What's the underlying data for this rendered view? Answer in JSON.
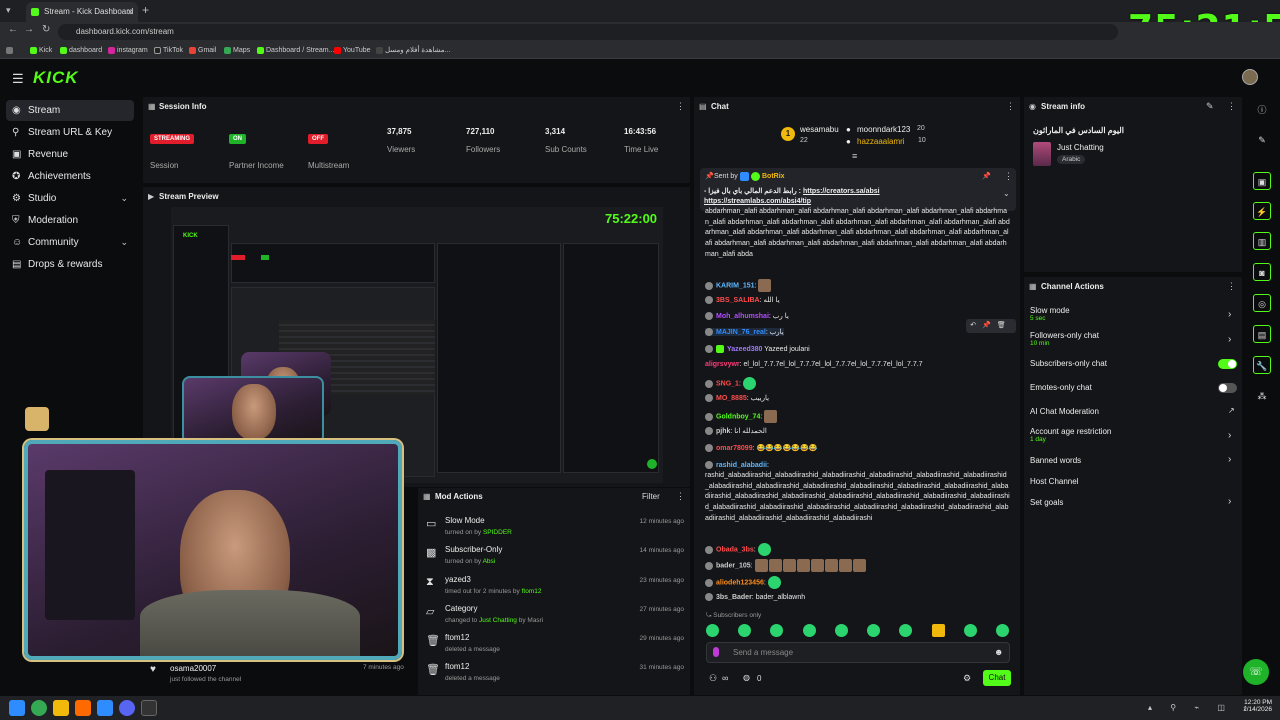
{
  "browser": {
    "tab_title": "Stream - Kick Dashboard",
    "url": "dashboard.kick.com/stream",
    "bookmarks": [
      "Kick",
      "dashboard",
      "instagram",
      "TikTok",
      "Gmail",
      "Maps",
      "Dashboard / Stream...",
      "YouTube",
      "مشاهدة أفلام ومسل..."
    ]
  },
  "overlay_timer": "75:21:55",
  "app": {
    "logo": "KICK"
  },
  "sidebar": {
    "items": [
      {
        "label": "Stream",
        "icon": "broadcast-icon"
      },
      {
        "label": "Stream URL & Key",
        "icon": "link-icon"
      },
      {
        "label": "Revenue",
        "icon": "revenue-icon"
      },
      {
        "label": "Achievements",
        "icon": "trophy-icon"
      },
      {
        "label": "Studio",
        "icon": "studio-icon"
      },
      {
        "label": "Moderation",
        "icon": "shield-icon"
      },
      {
        "label": "Community",
        "icon": "community-icon"
      },
      {
        "label": "Drops & rewards",
        "icon": "gift-icon"
      }
    ]
  },
  "session": {
    "title": "Session Info",
    "stats": [
      {
        "badge": "STREAMING",
        "label": "Session",
        "color": "#e11d2b"
      },
      {
        "badge": "ON",
        "label": "Partner Income",
        "color": "#1fb32a"
      },
      {
        "badge": "OFF",
        "label": "Multistream",
        "color": "#e11d2b"
      },
      {
        "value": "37,875",
        "label": "Viewers"
      },
      {
        "value": "727,110",
        "label": "Followers"
      },
      {
        "value": "3,314",
        "label": "Sub Counts"
      },
      {
        "value": "16:43:56",
        "label": "Time Live"
      }
    ]
  },
  "preview": {
    "title": "Stream Preview",
    "timer": "75:22:00"
  },
  "follow_event": {
    "user": "osama20007",
    "text": "just followed the channel",
    "time": "7 minutes ago"
  },
  "mod_actions": {
    "title": "Mod Actions",
    "filter": "Filter",
    "items": [
      {
        "title": "Slow Mode",
        "sub_pre": "turned on by ",
        "sub_user": "SPIDDER",
        "time": "12 minutes ago",
        "icon": "slow-mode-icon"
      },
      {
        "title": "Subscriber-Only",
        "sub_pre": "turned on by ",
        "sub_user": "Absi",
        "time": "14 minutes ago",
        "icon": "gift-icon"
      },
      {
        "title": "yazed3",
        "sub_pre": "timed out for 2 minutes by ",
        "sub_user": "ftom12",
        "time": "23 minutes ago",
        "icon": "hourglass-icon"
      },
      {
        "title": "Category",
        "sub_pre": "changed to ",
        "sub_user": "Just Chatting",
        "sub_post": " by Masri",
        "time": "27 minutes ago",
        "icon": "category-icon"
      },
      {
        "title": "ftom12",
        "sub_pre": "deleted a message",
        "sub_user": "",
        "time": "29 minutes ago",
        "icon": "trash-icon"
      },
      {
        "title": "ftom12",
        "sub_pre": "deleted a message",
        "sub_user": "",
        "time": "31 minutes ago",
        "icon": "trash-icon"
      }
    ]
  },
  "chat": {
    "title": "Chat",
    "top_gifters": [
      {
        "name": "wesamabu",
        "count": "22",
        "rank": "1"
      },
      {
        "name": "moonndark123",
        "count": "20"
      },
      {
        "name": "hazzaaalamri",
        "count": "10"
      }
    ],
    "pinned": {
      "by_label": "Sent by",
      "by_user": "BotRix",
      "text": "- رابط الدعم المالي باي بال فيزا : ",
      "link1": "https://creators.sa/absi",
      "link2": "https://streamlabs.com/absi4/tip"
    },
    "spam1": "abdarhman_alafi abdarhman_alafi abdarhman_alafi abdarhman_alafi abdarhman_alafi abdarhman_alafi abdarhman_alafi abdarhman_alafi abdarhman_alafi abdarhman_alafi abdarhman_alafi abdarhman_alafi abdarhman_alafi abdarhman_alafi abdarhman_alafi abdarhman_alafi abdarhman_alafi abdarhman_alafi abdarhman_alafi abdarhman_alafi abdarhman_alafi abdarhman_alafi abdarhman_alafi abda",
    "messages": [
      {
        "user": "KARIM_151",
        "color": "#5fb8ff",
        "text": "",
        "emotes": 1
      },
      {
        "user": "3BS_SALIBA",
        "color": "#ff4d4d",
        "text": "يا الله"
      },
      {
        "user": "Moh_alhumshai",
        "color": "#b44dff",
        "text": "يا رب"
      },
      {
        "user": "MAJIN_76_real",
        "color": "#2f8cff",
        "text": "يارب"
      },
      {
        "user": "Yazeed380",
        "color": "#9f7bff",
        "text": "Yazeed joulani"
      },
      {
        "user": "aligrsvywr",
        "color": "#ff3b7a",
        "text": "el_lol_7.7.7el_lol_7.7.7el_lol_7.7.7el_lol_7.7.7el_lol_7.7.7"
      },
      {
        "user": "SNG_1",
        "color": "#ff4d4d",
        "text": "",
        "gemotes": 1
      },
      {
        "user": "MO_8885",
        "color": "#ff4d4d",
        "text": "يارييب"
      },
      {
        "user": "Goldnboy_74",
        "color": "#53fc18",
        "text": "",
        "emotes": 1
      },
      {
        "user": "pjhk",
        "color": "#ccc",
        "text": "الحمدلله انا"
      },
      {
        "user": "omar78099",
        "color": "#ff4d4d",
        "text": "😂😂😂😂😂😂😂"
      }
    ],
    "spam2_user": "rashid_alabadii",
    "spam2": "rashid_alabadiirashid_alabadiirashid_alabadiirashid_alabadiirashid_alabadiirashid_alabadiirashid_alabadiirashid_alabadiirashid_alabadiirashid_alabadiirashid_alabadiirashid_alabadiirashid_alabadiirashid_alabadiirashid_alabadiirashid_alabadiirashid_alabadiirashid_alabadiirashid_alabadiirashid_alabadiirashid_alabadiirashid_alabadiirashid_alabadiirashid_alabadiirashid_alabadiirashid_alabadiirashid_alabadiirashid_alabadiirashid_alabadiirashi",
    "messages2": [
      {
        "user": "Obada_3bs",
        "color": "#ff4d4d",
        "text": "",
        "gemotes": 1
      },
      {
        "user": "bader_105",
        "color": "#ccc",
        "text": "",
        "emotes": 6
      },
      {
        "user": "aliodeh123456",
        "color": "#ff8c1a",
        "text": "",
        "gemotes": 1
      },
      {
        "user": "3bs_Bader",
        "color": "#ccc",
        "text": "bader_alblawnh"
      }
    ],
    "subscribers_only": "Subscribers only",
    "input_placeholder": "Send a message",
    "viewer_count": "0",
    "send_label": "Chat"
  },
  "stream_info": {
    "title": "Stream info",
    "stream_title": "اليوم السادس في الماراثون",
    "category": "Just Chatting",
    "language": "Arabic"
  },
  "channel_actions": {
    "title": "Channel Actions",
    "items": [
      {
        "label": "Slow mode",
        "sub": "5 sec",
        "control": "arrow"
      },
      {
        "label": "Followers-only chat",
        "sub": "10 min",
        "control": "arrow"
      },
      {
        "label": "Subscribers-only chat",
        "control": "toggle-on"
      },
      {
        "label": "Emotes-only chat",
        "control": "toggle-off"
      },
      {
        "label": "AI Chat Moderation",
        "control": "external"
      },
      {
        "label": "Account age restriction",
        "sub": "1 day",
        "control": "arrow"
      },
      {
        "label": "Banned words",
        "control": "arrow"
      },
      {
        "label": "Host Channel",
        "control": "none"
      },
      {
        "label": "Set goals",
        "control": "arrow"
      }
    ]
  },
  "taskbar": {
    "time": "12:20 PM",
    "date": "1/14/2026"
  },
  "colors": {
    "accent": "#53fc18",
    "panel": "#141518",
    "bg": "#0b0c0e",
    "live_red": "#e11d2b"
  }
}
